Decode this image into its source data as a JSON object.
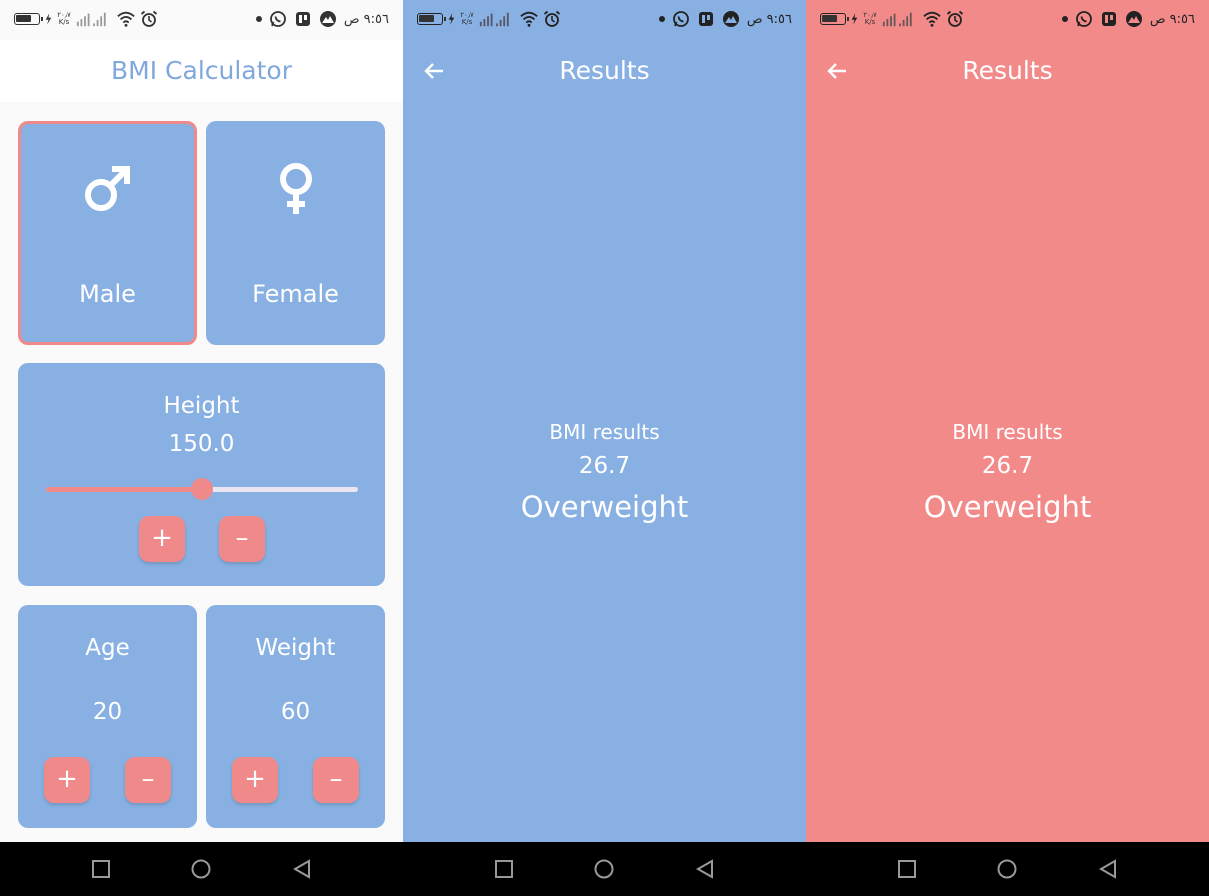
{
  "status_bar": {
    "time": "٩:٥٦ ص",
    "net_speed_top": "٢٠٫٧",
    "net_speed_bottom": "K/s"
  },
  "calculator": {
    "title": "BMI Calculator",
    "male": {
      "label": "Male",
      "icon": "male-icon",
      "selected": true
    },
    "female": {
      "label": "Female",
      "icon": "female-icon",
      "selected": false
    },
    "height": {
      "label": "Height",
      "value": "150.0",
      "slider_fraction": 0.5,
      "plus": "+",
      "minus": "–"
    },
    "age": {
      "label": "Age",
      "value": "20",
      "plus": "+",
      "minus": "–"
    },
    "weight": {
      "label": "Weight",
      "value": "60",
      "plus": "+",
      "minus": "–"
    }
  },
  "results_blue": {
    "title": "Results",
    "label": "BMI results",
    "value": "26.7",
    "category": "Overweight",
    "background": "#88b0e2"
  },
  "results_red": {
    "title": "Results",
    "label": "BMI results",
    "value": "26.7",
    "category": "Overweight",
    "background": "#f38a8a"
  },
  "colors": {
    "card": "#88b0e2",
    "accent": "#f08a8a",
    "title_text": "#80a8dc"
  }
}
